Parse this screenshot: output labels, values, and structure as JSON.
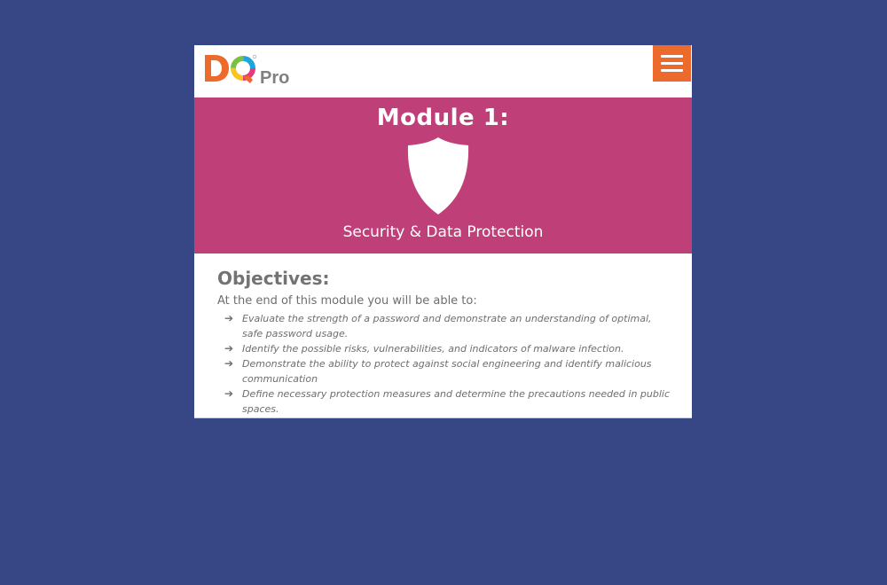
{
  "brand": {
    "logo_letters": "DQ",
    "logo_suffix": "Pro",
    "colors": {
      "d_orange": "#ec6a2c",
      "ring_pink": "#e8397a",
      "ring_yellow": "#f6c523",
      "ring_green": "#7ac143",
      "ring_blue": "#1fa5de"
    }
  },
  "header": {
    "menu_icon": "hamburger-menu-icon",
    "menu_color": "#ec6a2c"
  },
  "banner": {
    "title": "Module 1:",
    "icon": "shield-icon",
    "subtitle": "Security & Data Protection",
    "background": "#bf4078"
  },
  "objectives": {
    "heading": "Objectives:",
    "intro": "At the end of this module you will be able to:",
    "items": [
      "Evaluate the strength of a password and demonstrate an understanding of optimal, safe password usage.",
      "Identify the possible risks, vulnerabilities, and indicators of malware infection.",
      "Demonstrate the ability to protect against social engineering and identify malicious communication",
      "Define necessary protection measures and determine the precautions needed in public spaces."
    ],
    "bullet_icon": "arrow-right-icon"
  },
  "page": {
    "background": "#374685"
  }
}
